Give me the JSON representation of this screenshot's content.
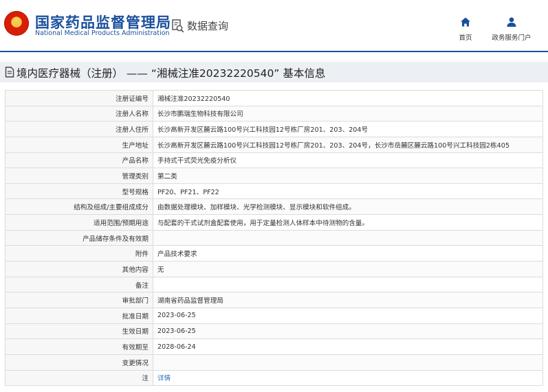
{
  "header": {
    "title_cn": "国家药品监督管理局",
    "title_en": "National Medical Products Administration",
    "query_label": "数据查询",
    "nav": [
      {
        "label": "首页",
        "icon": "home-icon"
      },
      {
        "label": "政务服务门户",
        "icon": "user-icon"
      }
    ]
  },
  "page": {
    "title": "境内医疗器械（注册） —— “湘械注准20232220540” 基本信息"
  },
  "rows": [
    {
      "label": "注册证编号",
      "value": "湘械注准20232220540"
    },
    {
      "label": "注册人名称",
      "value": "长沙市鹏瑞生物科技有限公司"
    },
    {
      "label": "注册人住所",
      "value": "长沙高新开发区麓云路100号兴工科技园12号栋厂房201、203、204号"
    },
    {
      "label": "生产地址",
      "value": "长沙高新开发区麓云路100号兴工科技园12号栋厂房201、203、204号，长沙市岳麓区麓云路100号兴工科技园2栋405"
    },
    {
      "label": "产品名称",
      "value": "手持式干式荧光免疫分析仪"
    },
    {
      "label": "管理类别",
      "value": "第二类"
    },
    {
      "label": "型号规格",
      "value": "PF20、PF21、PF22"
    },
    {
      "label": "结构及组成/主要组成成分",
      "value": "由数据处理模块、加样模块、光学检测模块、显示模块和软件组成。"
    },
    {
      "label": "适用范围/预期用途",
      "value": "与配套的干式试剂盒配套使用，用于定量检测人体样本中待测物的含量。"
    },
    {
      "label": "产品储存条件及有效期",
      "value": ""
    },
    {
      "label": "附件",
      "value": "产品技术要求"
    },
    {
      "label": "其他内容",
      "value": "无"
    },
    {
      "label": "备注",
      "value": ""
    },
    {
      "label": "审批部门",
      "value": "湖南省药品监督管理局"
    },
    {
      "label": "批准日期",
      "value": "2023-06-25"
    },
    {
      "label": "生效日期",
      "value": "2023-06-25"
    },
    {
      "label": "有效期至",
      "value": "2028-06-24"
    },
    {
      "label": "变更情况",
      "value": ""
    },
    {
      "label": "注",
      "value": "详情"
    }
  ],
  "colors": {
    "brand": "#1a4f9c",
    "link": "#2a6fb8"
  }
}
